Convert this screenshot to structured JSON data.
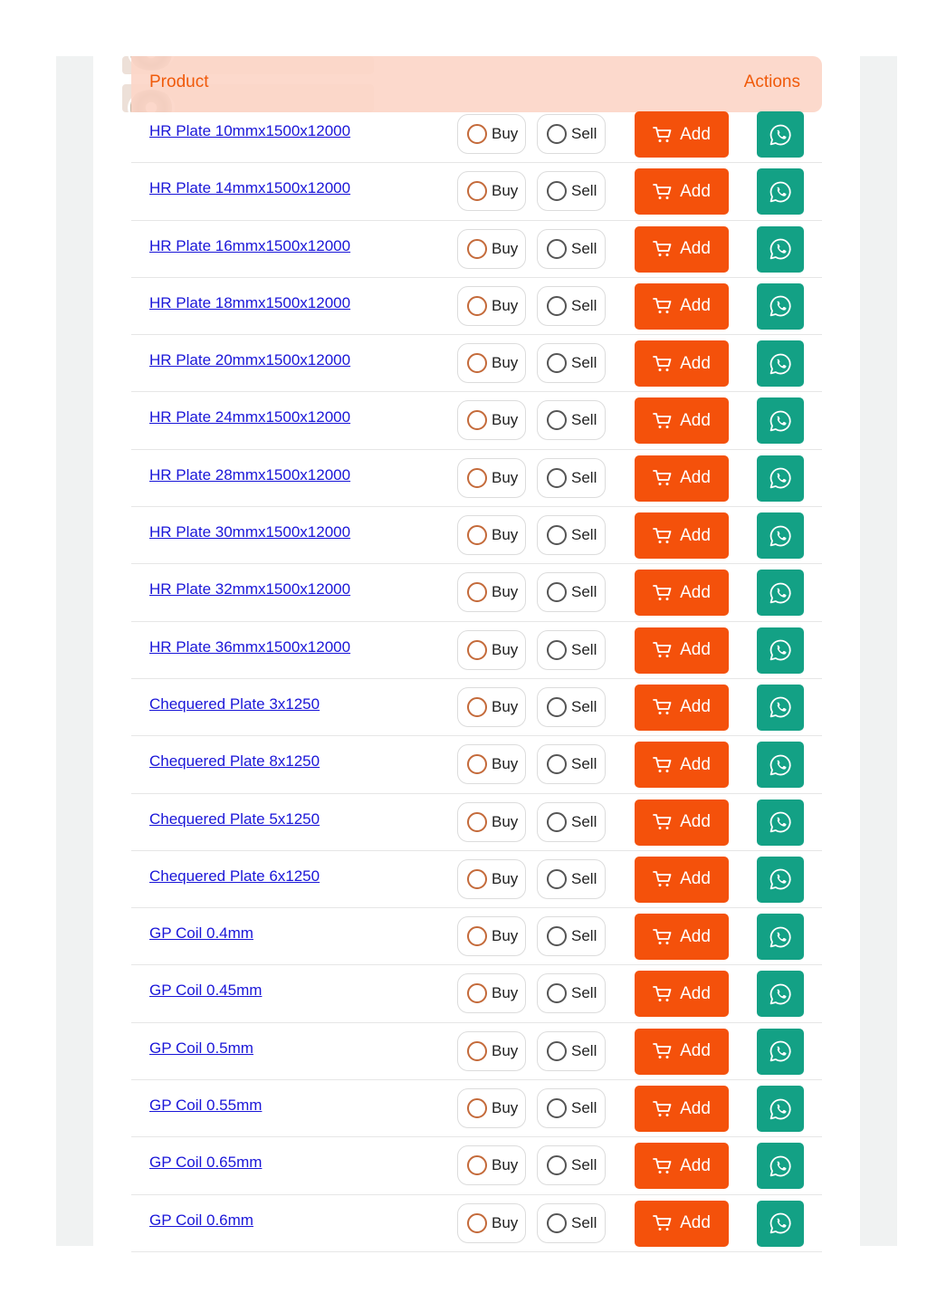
{
  "table": {
    "header": {
      "product": "Product",
      "actions": "Actions"
    },
    "buy_label": "Buy",
    "sell_label": "Sell",
    "add_label": "Add",
    "rows": [
      {
        "name": "HR Plate 10mmx1500x12000"
      },
      {
        "name": "HR Plate 14mmx1500x12000"
      },
      {
        "name": "HR Plate 16mmx1500x12000"
      },
      {
        "name": "HR Plate 18mmx1500x12000"
      },
      {
        "name": "HR Plate 20mmx1500x12000"
      },
      {
        "name": "HR Plate 24mmx1500x12000"
      },
      {
        "name": "HR Plate 28mmx1500x12000"
      },
      {
        "name": "HR Plate 30mmx1500x12000"
      },
      {
        "name": "HR Plate 32mmx1500x12000"
      },
      {
        "name": "HR Plate 36mmx1500x12000"
      },
      {
        "name": "Chequered Plate 3x1250"
      },
      {
        "name": "Chequered Plate 8x1250"
      },
      {
        "name": "Chequered Plate 5x1250"
      },
      {
        "name": "Chequered Plate 6x1250"
      },
      {
        "name": "GP Coil 0.4mm"
      },
      {
        "name": "GP Coil 0.45mm"
      },
      {
        "name": "GP Coil 0.5mm"
      },
      {
        "name": "GP Coil 0.55mm"
      },
      {
        "name": "GP Coil 0.65mm"
      },
      {
        "name": "GP Coil 0.6mm"
      }
    ]
  },
  "icons": {
    "cart": "cart-icon",
    "whatsapp": "whatsapp-icon",
    "arrow": "arrow-right-icon"
  },
  "colors": {
    "accent": "#f4510b",
    "header_bg": "#fcd6c8",
    "header_text": "#f05a0a",
    "whatsapp": "#13a185",
    "link": "#1a16d8"
  }
}
